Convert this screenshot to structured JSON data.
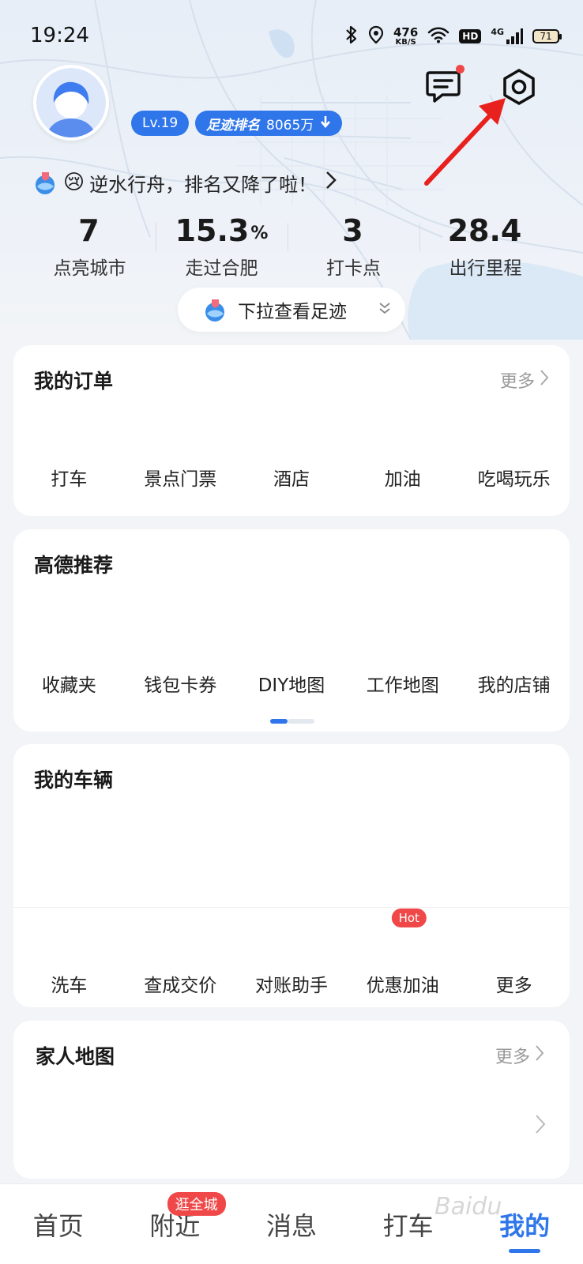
{
  "status": {
    "time": "19:24",
    "net_speed": "476",
    "net_unit": "KB/S",
    "hd": "HD",
    "signal": "4G",
    "battery": "71"
  },
  "profile": {
    "level": "Lv.19",
    "rank_label": "足迹排名",
    "rank_value": "8065万",
    "rank_trend_icon": "down-arrow-icon",
    "slogan": "逆水行舟，排名又降了啦！",
    "slogan_emoji": "😢"
  },
  "stats": [
    {
      "value": "7",
      "unit": "",
      "label": "点亮城市"
    },
    {
      "value": "15.3",
      "unit": "%",
      "label": "走过合肥"
    },
    {
      "value": "3",
      "unit": "",
      "label": "打卡点"
    },
    {
      "value": "28.4",
      "unit": "",
      "label": "出行里程"
    }
  ],
  "pull_hint": "下拉查看足迹",
  "orders": {
    "title": "我的订单",
    "more": "更多",
    "items": [
      "打车",
      "景点门票",
      "酒店",
      "加油",
      "吃喝玩乐"
    ]
  },
  "recommend": {
    "title": "高德推荐",
    "items": [
      "收藏夹",
      "钱包卡券",
      "DIY地图",
      "工作地图",
      "我的店铺"
    ]
  },
  "vehicles": {
    "title": "我的车辆",
    "items": [
      "洗车",
      "查成交价",
      "对账助手",
      "优惠加油",
      "更多"
    ],
    "hot_tag": "Hot"
  },
  "family": {
    "title": "家人地图",
    "more": "更多"
  },
  "tabbar": {
    "tabs": [
      "首页",
      "附近",
      "消息",
      "打车",
      "我的"
    ],
    "nearby_badge": "逛全城",
    "active_index": 4
  },
  "watermark": "Baidu",
  "colors": {
    "accent": "#2f76ea",
    "badge_red": "#f04848",
    "annotation_arrow": "#e8211f"
  },
  "icons": {
    "message": "message-icon",
    "settings": "settings-icon",
    "avatar": "avatar-icon",
    "logo": "amap-logo-icon"
  }
}
